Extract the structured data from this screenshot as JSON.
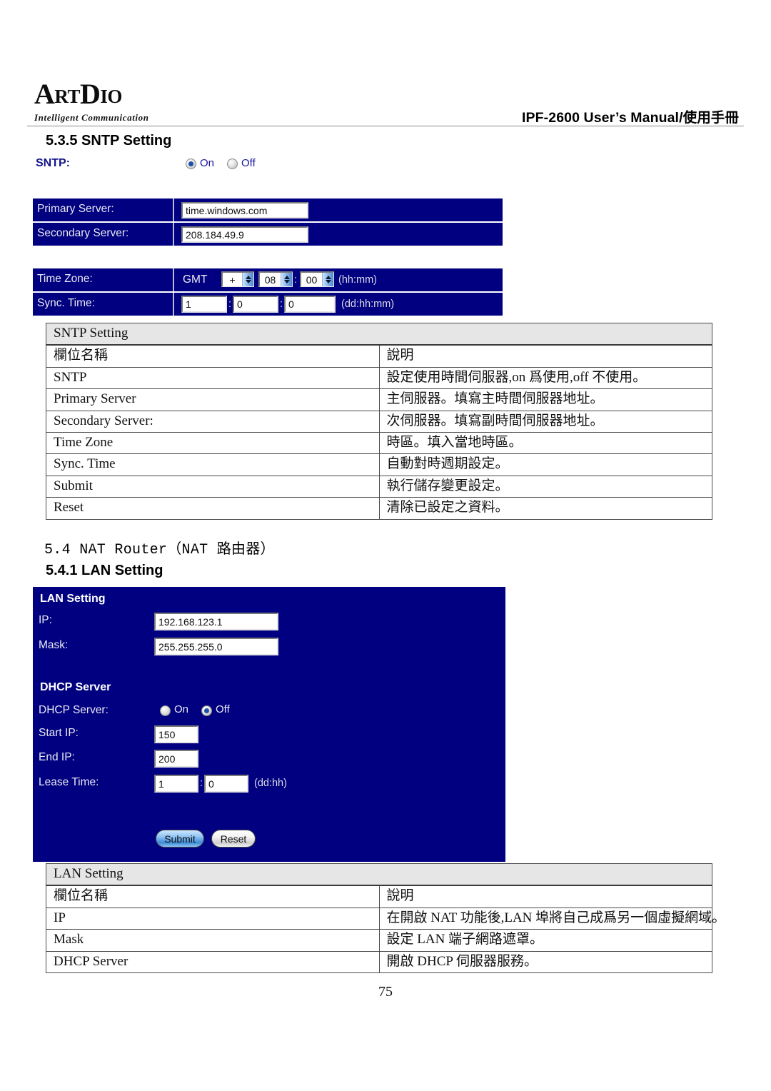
{
  "header": {
    "logo_main_a": "A",
    "logo_main_rt": "RT",
    "logo_main_d": "D",
    "logo_main_io": "IO",
    "logo_tagline": "Intelligent Communication",
    "title": "IPF-2600 User’s Manual/使用手冊"
  },
  "sections": {
    "sntp_heading": "5.3.5 SNTP Setting",
    "nat_heading": "5.4 NAT Router（NAT 路由器）",
    "lan_heading": "5.4.1 LAN Setting"
  },
  "sntp_panel": {
    "sntp_label": "SNTP:",
    "radio_on": "On",
    "radio_off": "Off",
    "sntp_selected": "On",
    "primary_server_label": "Primary Server:",
    "primary_server_value": "time.windows.com",
    "secondary_server_label": "Secondary Server:",
    "secondary_server_value": "208.184.49.9",
    "time_zone_label": "Time Zone:",
    "gmt_label": "GMT",
    "tz_sign": "+",
    "tz_hours": "08",
    "tz_minutes": "00",
    "tz_colon": ":",
    "tz_format_note": "(hh:mm)",
    "sync_time_label": "Sync. Time:",
    "sync_days": "1",
    "sync_hours": "0",
    "sync_minutes": "0",
    "sync_sep1": ":",
    "sync_sep2": ":",
    "sync_format_note": "(dd:hh:mm)"
  },
  "sntp_table": {
    "title": "SNTP Setting",
    "headers": [
      "欄位名稱",
      "說明"
    ],
    "rows": [
      {
        "name": "SNTP",
        "desc": "設定使用時間伺服器,on 爲使用,off 不使用。"
      },
      {
        "name": "Primary Server",
        "desc": "主伺服器。填寫主時間伺服器地址。"
      },
      {
        "name": "Secondary Server:",
        "desc": "次伺服器。填寫副時間伺服器地址。"
      },
      {
        "name": "Time Zone",
        "desc": "時區。填入當地時區。"
      },
      {
        "name": "Sync. Time",
        "desc": "自動對時週期設定。"
      },
      {
        "name": "Submit",
        "desc": "執行儲存變更設定。"
      },
      {
        "name": "Reset",
        "desc": "清除已設定之資料。"
      }
    ]
  },
  "lan_panel": {
    "lan_section_title": "LAN Setting",
    "ip_label": "IP:",
    "ip_value": "192.168.123.1",
    "mask_label": "Mask:",
    "mask_value": "255.255.255.0",
    "dhcp_section_title": "DHCP Server",
    "dhcp_label": "DHCP Server:",
    "radio_on": "On",
    "radio_off": "Off",
    "dhcp_selected": "Off",
    "start_ip_label": "Start IP:",
    "start_ip_value": "150",
    "end_ip_label": "End IP:",
    "end_ip_value": "200",
    "lease_time_label": "Lease Time:",
    "lease_days": "1",
    "lease_hours": "0",
    "lease_sep": ":",
    "lease_format_note": "(dd:hh)",
    "submit_label": "Submit",
    "reset_label": "Reset"
  },
  "lan_table": {
    "title": "LAN Setting",
    "headers": [
      "欄位名稱",
      "說明"
    ],
    "rows": [
      {
        "name": "IP",
        "desc": "在開啟 NAT 功能後,LAN 埠將自己成爲另一個虛擬網域。"
      },
      {
        "name": "Mask",
        "desc": "設定 LAN 端子網路遮罩。"
      },
      {
        "name": "DHCP Server",
        "desc": "開啟 DHCP 伺服器服務。"
      }
    ]
  },
  "footer": {
    "page_number": "75"
  }
}
